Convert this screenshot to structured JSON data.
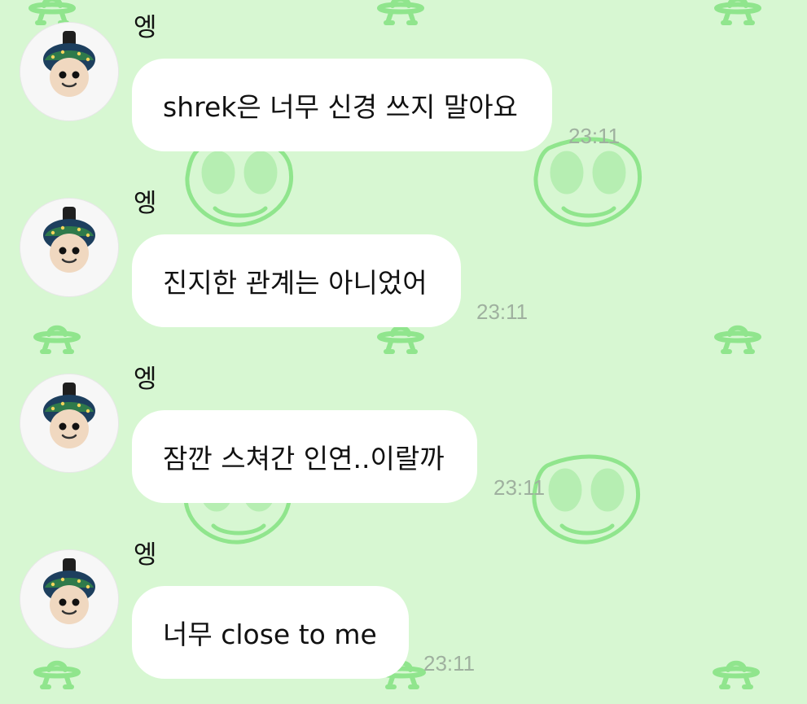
{
  "chat": {
    "messages": [
      {
        "sender": "엥",
        "text": "shrek은 너무 신경 쓰지 말아요",
        "time": "23:11"
      },
      {
        "sender": "엥",
        "text": "진지한 관계는 아니었어",
        "time": "23:11"
      },
      {
        "sender": "엥",
        "text": "잠깐 스쳐간 인연..이랄까",
        "time": "23:11"
      },
      {
        "sender": "엥",
        "text": "너무 close to me",
        "time": "23:11"
      }
    ]
  },
  "theme": {
    "wallpaper_color": "#d7f7d2",
    "wallpaper_pattern_color": "#90e58d",
    "bubble_color": "#ffffff",
    "text_color": "#111111",
    "time_color": "#9fb09f",
    "wallpaper_icons": [
      "ufo-icon",
      "alien-face-icon"
    ]
  }
}
